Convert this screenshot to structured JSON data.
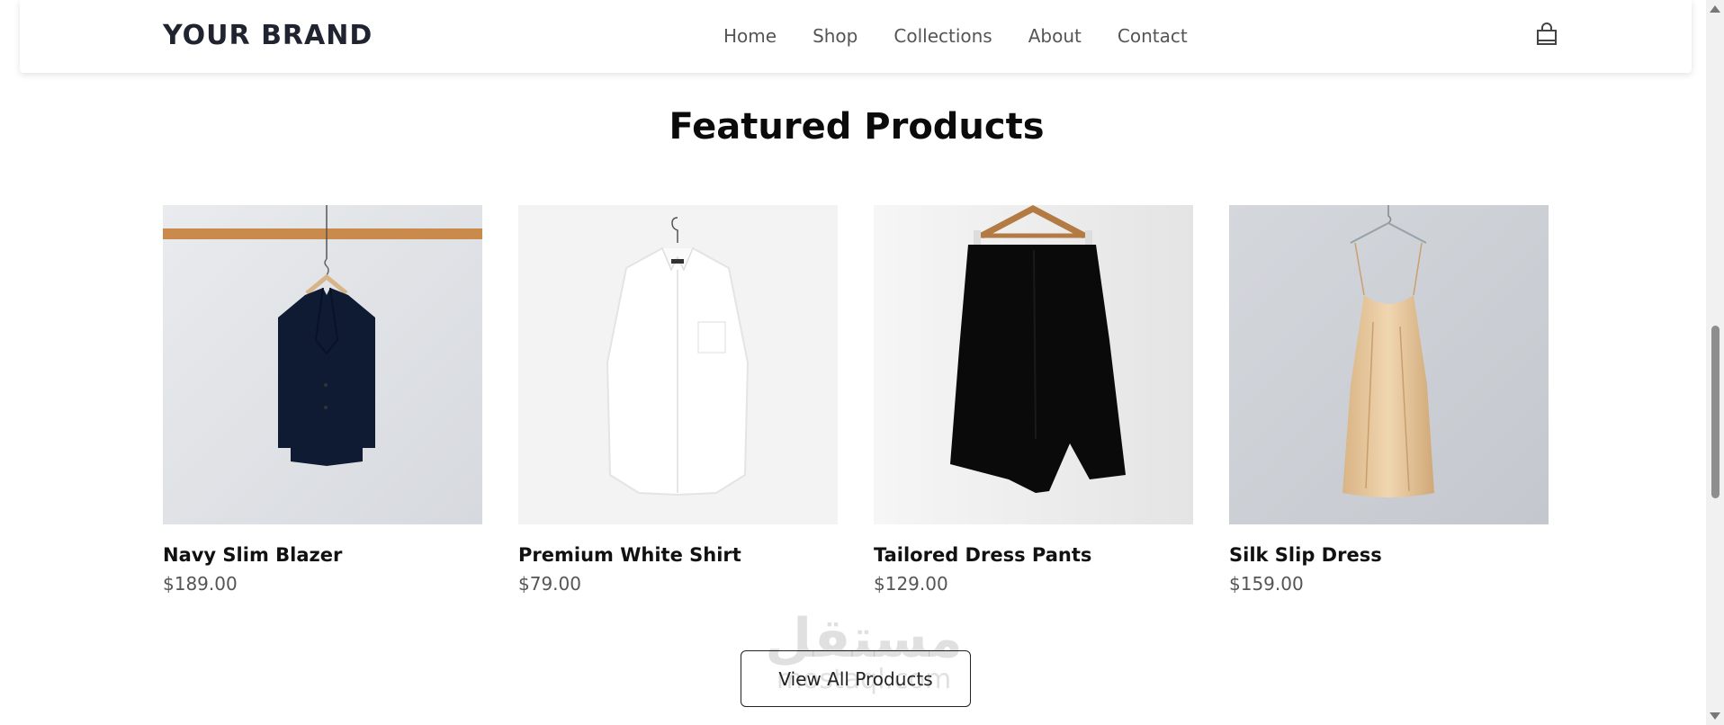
{
  "header": {
    "brand": "YOUR BRAND",
    "nav": [
      "Home",
      "Shop",
      "Collections",
      "About",
      "Contact"
    ],
    "cart_icon": "shopping-bag-icon"
  },
  "section": {
    "title": "Featured Products"
  },
  "products": [
    {
      "name": "Navy Slim Blazer",
      "price": "$189.00",
      "image": "navy-blazer-on-hanger"
    },
    {
      "name": "Premium White Shirt",
      "price": "$79.00",
      "image": "white-shirt-on-hanger"
    },
    {
      "name": "Tailored Dress Pants",
      "price": "$129.00",
      "image": "black-pants-on-hanger"
    },
    {
      "name": "Silk Slip Dress",
      "price": "$159.00",
      "image": "champagne-slip-dress-on-hanger"
    }
  ],
  "cta": {
    "label": "View All Products"
  },
  "watermark": {
    "arabic": "مستقل",
    "latin": "mostaql.com"
  },
  "colors": {
    "brand_text": "#1f2430",
    "nav_text": "#555555",
    "price_text": "#555555",
    "rod": "#c98a4b",
    "blazer": "#0f1a33",
    "dress": "#e8c9a0"
  }
}
